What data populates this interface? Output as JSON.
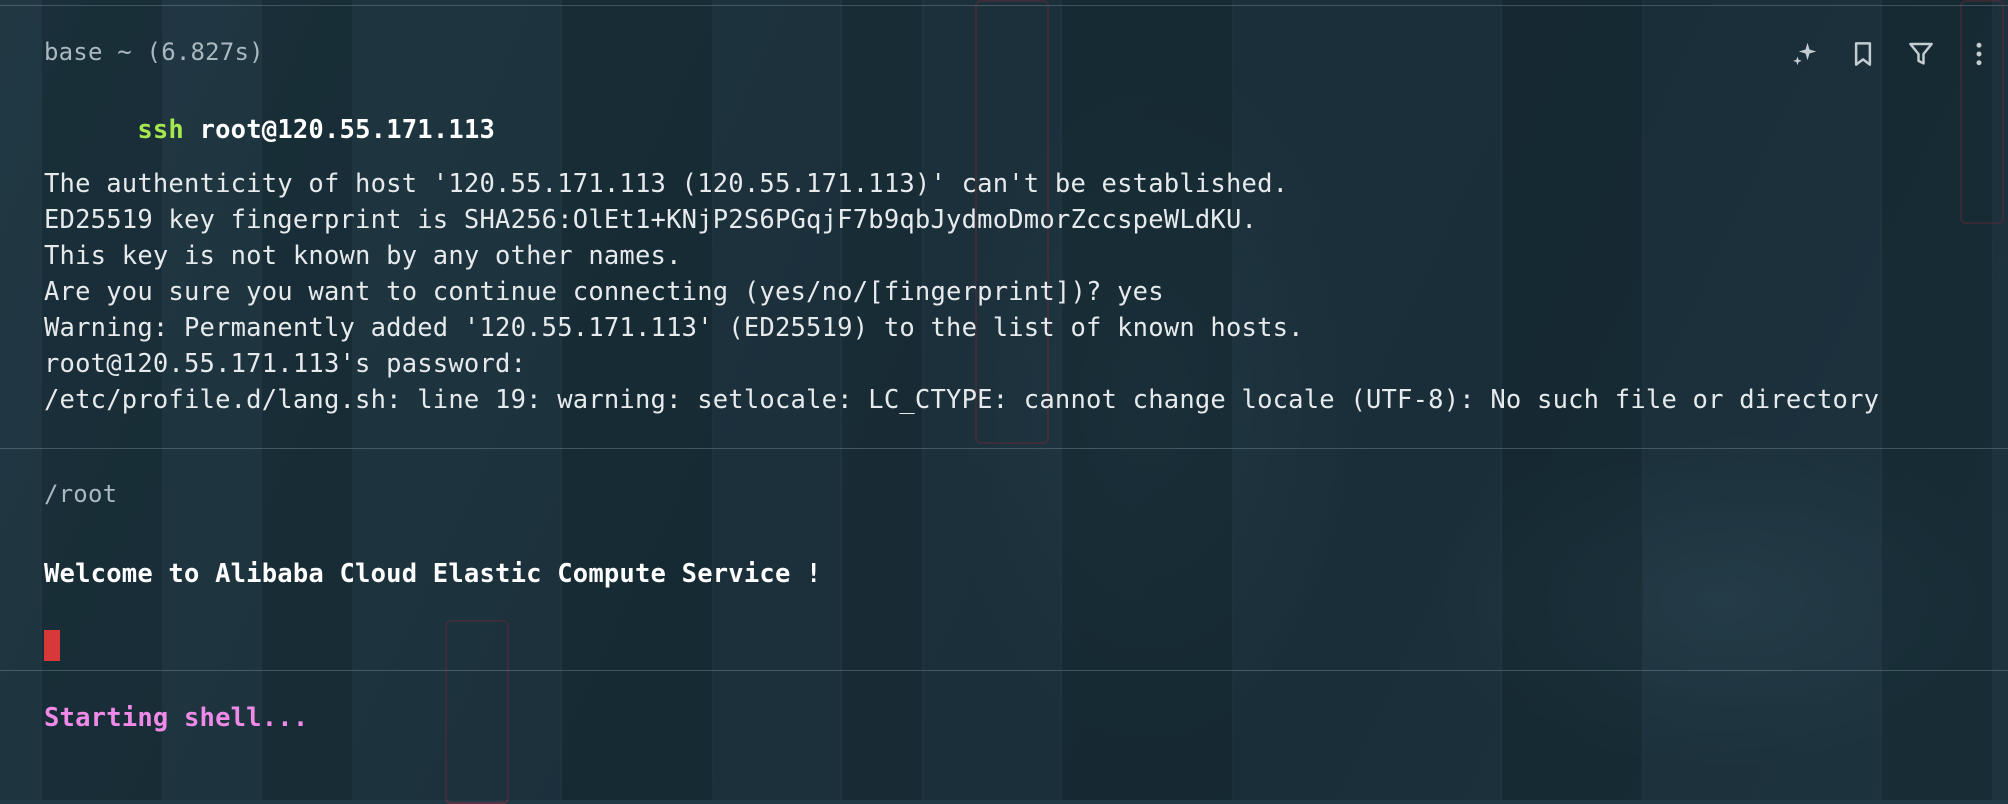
{
  "blocks": [
    {
      "meta": "base ~ (6.827s)",
      "command": {
        "name": "ssh",
        "args": "root@120.55.171.113"
      },
      "output": [
        "The authenticity of host '120.55.171.113 (120.55.171.113)' can't be established.",
        "ED25519 key fingerprint is SHA256:OlEt1+KNjP2S6PGqjF7b9qbJydmoDmorZccspeWLdKU.",
        "This key is not known by any other names.",
        "Are you sure you want to continue connecting (yes/no/[fingerprint])? yes",
        "Warning: Permanently added '120.55.171.113' (ED25519) to the list of known hosts.",
        "root@120.55.171.113's password:",
        "/etc/profile.d/lang.sh: line 19: warning: setlocale: LC_CTYPE: cannot change locale (UTF-8): No such file or directory"
      ]
    },
    {
      "meta": "/root",
      "output": [
        "Welcome to Alibaba Cloud Elastic Compute Service !"
      ]
    },
    {
      "output": [
        "Starting shell..."
      ]
    }
  ],
  "toolbar": {
    "icons": [
      "sparkle-icon",
      "bookmark-icon",
      "filter-icon",
      "more-vertical-icon"
    ]
  },
  "colors": {
    "command": "#a6e94f",
    "status": "#f08ae8",
    "cursor": "#d9383a"
  }
}
